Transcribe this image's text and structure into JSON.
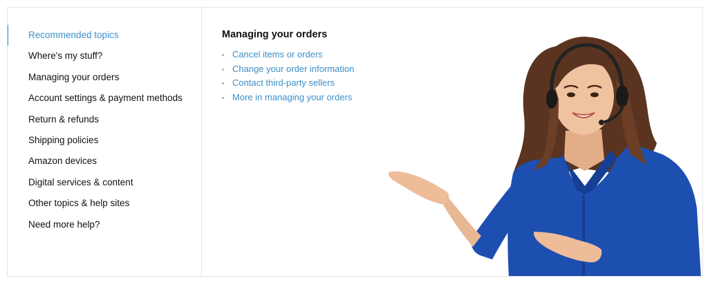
{
  "sidebar": {
    "items": [
      {
        "label": "Recommended topics"
      },
      {
        "label": "Where's my stuff?"
      },
      {
        "label": "Managing your orders"
      },
      {
        "label": "Account settings & payment methods"
      },
      {
        "label": "Return & refunds"
      },
      {
        "label": "Shipping policies"
      },
      {
        "label": "Amazon devices"
      },
      {
        "label": "Digital services & content"
      },
      {
        "label": "Other topics & help sites"
      },
      {
        "label": "Need more help?"
      }
    ]
  },
  "main": {
    "heading": "Managing your orders",
    "links": [
      {
        "label": "Cancel items or orders"
      },
      {
        "label": "Change your order information"
      },
      {
        "label": "Contact third-party sellers"
      },
      {
        "label": "More in managing your orders"
      }
    ]
  },
  "colors": {
    "accent": "#3b8fc7",
    "text": "#111111",
    "border": "#e3e3e3",
    "shirt": "#1d4fb0",
    "hair": "#5a3420",
    "skin": "#e8b894"
  },
  "illustration": {
    "subject": "customer-support-agent-with-headset"
  }
}
